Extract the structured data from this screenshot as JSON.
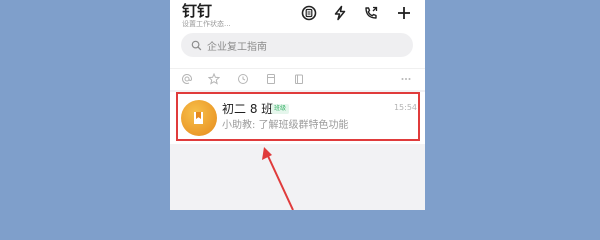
{
  "app": {
    "title": "钉钉",
    "status_placeholder": "设置工作状态..."
  },
  "toolbar": {
    "icons": [
      "contacts-icon",
      "lightning-icon",
      "phone-icon",
      "plus-icon"
    ]
  },
  "search": {
    "placeholder": "企业复工指南"
  },
  "filters": {
    "icons": [
      "at-icon",
      "star-icon",
      "clock-icon",
      "document-icon",
      "folder-icon",
      "more-icon"
    ]
  },
  "chat": {
    "name": "初二 8 班",
    "badge": "班级",
    "time": "15:54",
    "preview": "小助教: 了解班级群特色功能"
  },
  "annotation": {
    "color": "#e03b3b"
  }
}
